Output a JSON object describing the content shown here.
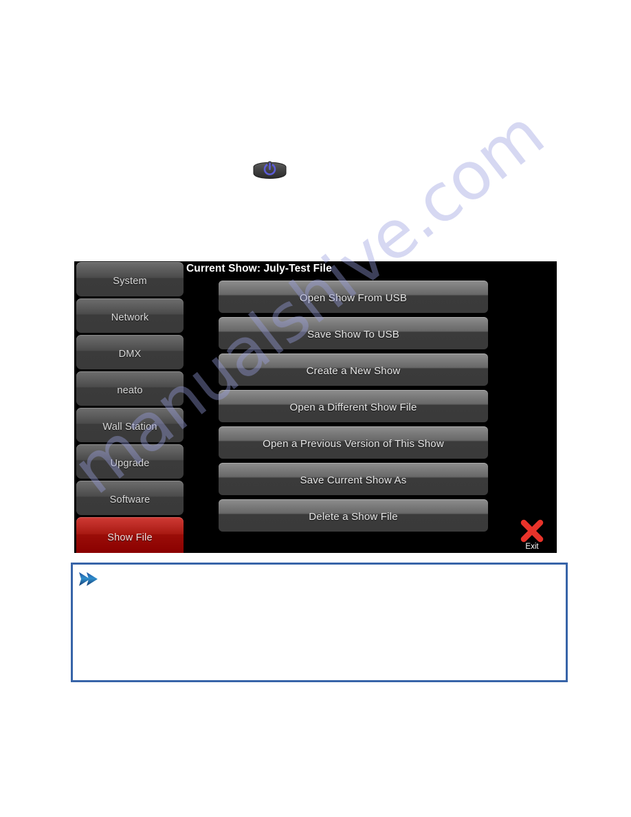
{
  "page": {
    "watermark": "manualshive.com",
    "background_color": "#ffffff"
  },
  "power_graphic": {
    "icon": "power-symbol-icon",
    "glyph_color": "#5b5bd6",
    "body_color": "#3e3e3e"
  },
  "device_panel": {
    "background_color": "#000000",
    "header": {
      "current_show_label": "Current Show: July-Test File"
    },
    "sidebar": {
      "items": [
        {
          "label": "System",
          "active": false
        },
        {
          "label": "Network",
          "active": false
        },
        {
          "label": "DMX",
          "active": false
        },
        {
          "label": "neato",
          "active": false
        },
        {
          "label": "Wall Station",
          "active": false
        },
        {
          "label": "Upgrade",
          "active": false
        },
        {
          "label": "Software",
          "active": false
        },
        {
          "label": "Show File",
          "active": true
        }
      ],
      "active_color": "#a81912",
      "inactive_color": "#3a3a3a"
    },
    "actions": [
      {
        "label": "Open Show From USB"
      },
      {
        "label": "Save Show To USB"
      },
      {
        "label": "Create a New Show"
      },
      {
        "label": "Open a Different Show File"
      },
      {
        "label": "Open a Previous Version of This Show"
      },
      {
        "label": "Save Current Show As"
      },
      {
        "label": "Delete a Show File"
      }
    ],
    "exit": {
      "label": "Exit",
      "icon": "close-x-icon",
      "icon_color": "#e8332a"
    }
  },
  "note_box": {
    "icon": "double-arrow-right-icon",
    "icon_color": "#2b7ec4",
    "border_color": "#3764a8",
    "text": ""
  }
}
